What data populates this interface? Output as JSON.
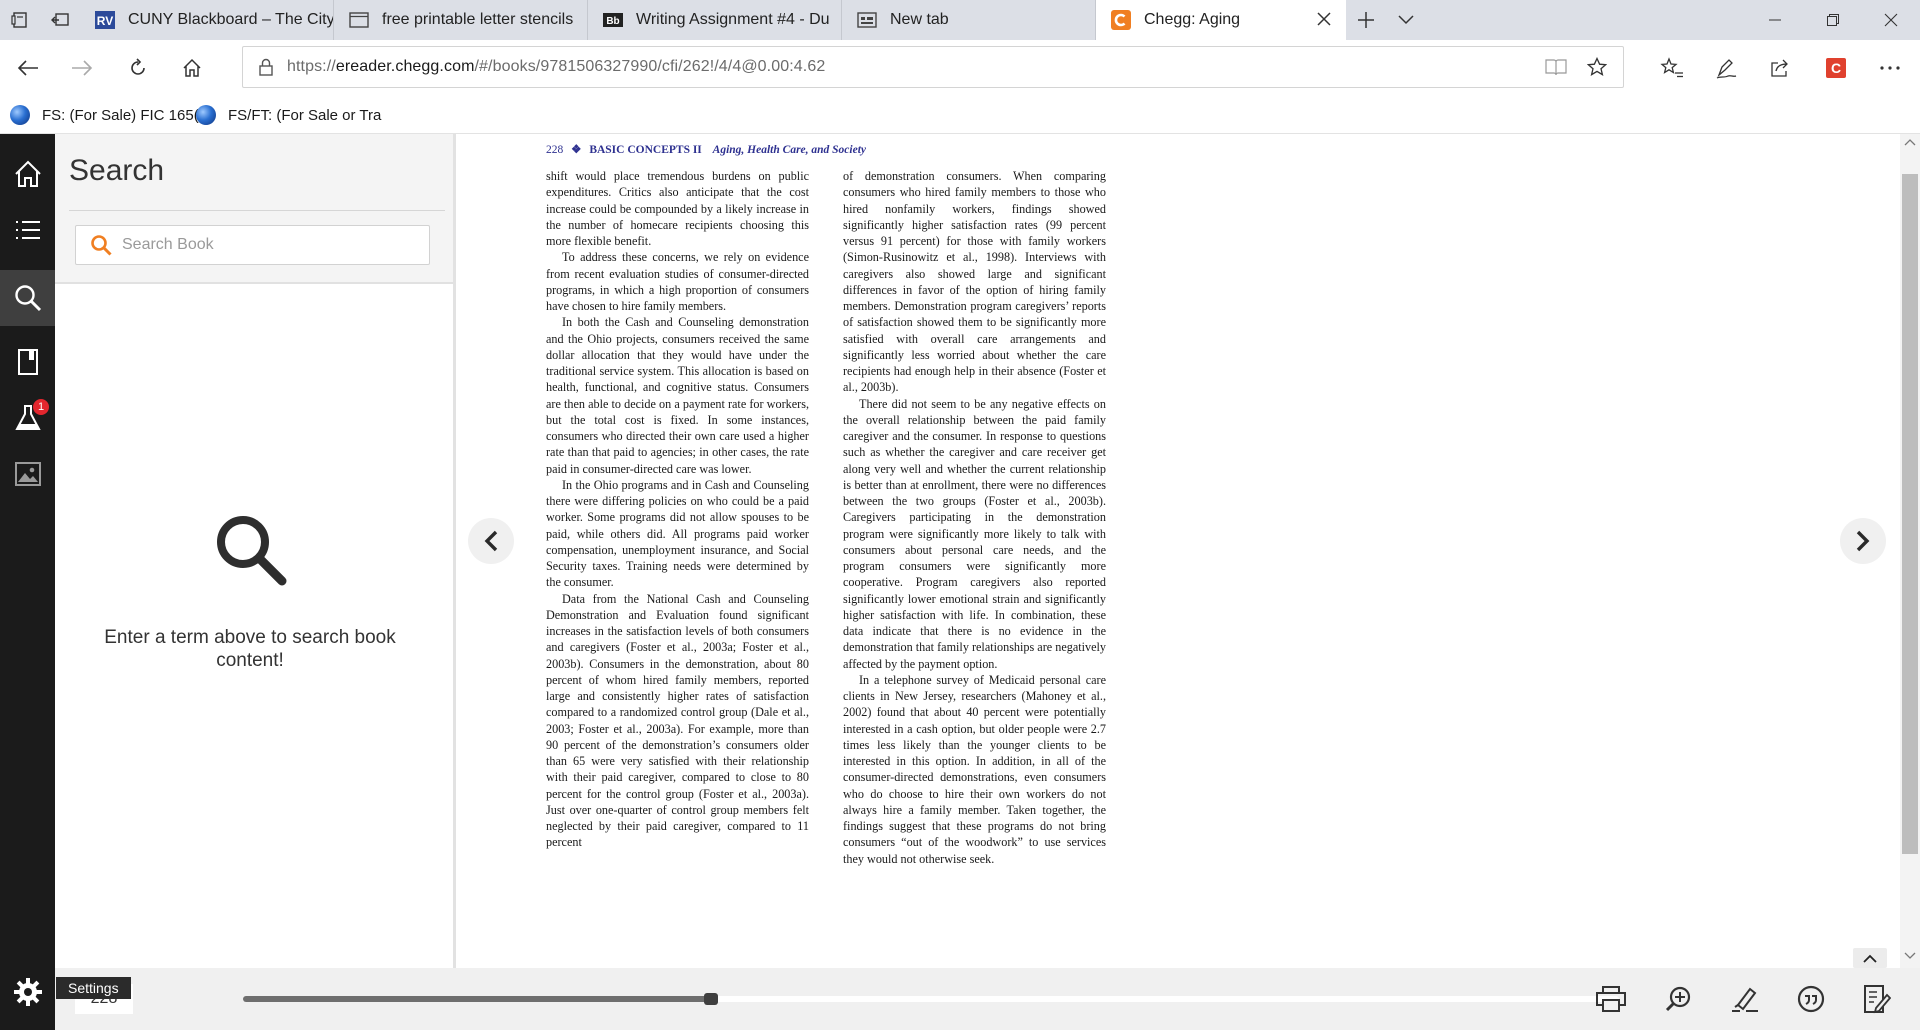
{
  "browser": {
    "tabs": [
      {
        "title": "CUNY Blackboard – The City",
        "icon": "cuny-logo-icon"
      },
      {
        "title": "free printable letter stencils",
        "icon": "page-icon"
      },
      {
        "title": "Writing Assignment #4 - Du",
        "icon": "blackboard-logo-icon"
      },
      {
        "title": "New tab",
        "icon": "new-tab-icon"
      },
      {
        "title": "Chegg: Aging",
        "icon": "chegg-logo-icon",
        "active": true
      }
    ],
    "url_prefix": "https://",
    "url_host": "ereader.chegg.com",
    "url_path": "/#/books/9781506327990/cfi/262!/4/4@0.00:4.62",
    "favorites": [
      {
        "label": "FS: (For Sale) FIC 165("
      },
      {
        "label": "FS/FT: (For Sale or Tra"
      }
    ],
    "extension_badge": "C"
  },
  "sidebar": {
    "badge_count": "1",
    "settings_tooltip": "Settings"
  },
  "search": {
    "title": "Search",
    "placeholder": "Search Book",
    "empty_message": "Enter a term above to search book content!"
  },
  "book": {
    "page_number": "228",
    "section": "BASIC CONCEPTS II",
    "book_title": "Aging, Health Care, and Society",
    "column_left": [
      "shift would place tremendous burdens on public expenditures. Critics also anticipate that the cost increase could be compounded by a likely increase in the number of homecare recipients choosing this more flexible benefit.",
      "To address these concerns, we rely on evidence from recent evaluation studies of consumer-directed programs, in which a high proportion of consumers have chosen to hire family members.",
      "In both the Cash and Counseling demonstration and the Ohio projects, consumers received the same dollar allocation that they would have under the traditional service system. This allocation is based on health, functional, and cognitive status. Consumers are then able to decide on a payment rate for workers, but the total cost is fixed. In some instances, consumers who directed their own care used a higher rate than that paid to agencies; in other cases, the rate paid in consumer-directed care was lower.",
      "In the Ohio programs and in Cash and Counseling there were differing policies on who could be a paid worker. Some programs did not allow spouses to be paid, while others did. All programs paid worker compensation, unemployment insurance, and Social Security taxes. Training needs were determined by the consumer.",
      "Data from the National Cash and Counseling Demonstration and Evaluation found significant increases in the satisfaction levels of both consumers and caregivers (Foster et al., 2003a; Foster et al., 2003b). Consumers in the demonstration, about 80 percent of whom hired family members, reported large and consistently higher rates of satisfaction compared to a randomized control group (Dale et al., 2003; Foster et al., 2003a). For example, more than 90 percent of the demonstration’s consumers older than 65 were very satisfied with their relationship with their paid caregiver, compared to close to 80 percent for the control group (Foster et al., 2003a). Just over one-quarter of control group members felt neglected by their paid caregiver, compared to 11 percent"
    ],
    "column_right": [
      "of demonstration consumers. When comparing consumers who hired family members to those who hired nonfamily workers, findings showed significantly higher satisfaction rates (99 percent versus 91 percent) for those with family workers (Simon-Rusinowitz et al., 1998). Interviews with caregivers also showed large and significant differences in favor of the option of hiring family members. Demonstration program caregivers’ reports of satisfaction showed them to be significantly more satisfied with overall care arrangements and significantly less worried about whether the care recipients had enough help in their absence (Foster et al., 2003b).",
      "There did not seem to be any negative effects on the overall relationship between the paid family caregiver and the consumer. In response to questions such as whether the caregiver and care receiver get along very well and whether the current relationship is better than at enrollment, there were no differences between the two groups (Foster et al., 2003b). Caregivers participating in the demonstration program were significantly more likely to talk with consumers about personal care needs, and the program consumers were significantly more cooperative. Program caregivers also reported significantly lower emotional strain and significantly higher satisfaction with life. In combination, these data indicate that there is no evidence in the demonstration that family relationships are negatively affected by the payment option.",
      "In a telephone survey of Medicaid personal care clients in New Jersey, researchers (Mahoney et al., 2002) found that about 40 percent were potentially interested in a cash option, but older people were 2.7 times less likely than the younger clients to be interested in this option. In addition, in all of the consumer-directed demonstrations, even consumers who do choose to hire their own workers do not always hire a family member. Taken together, the findings suggest that these programs do not bring consumers “out of the woodwork” to use services they would not otherwise seek."
    ]
  },
  "reader": {
    "current_page": "228",
    "progress_fraction": 0.34
  },
  "colors": {
    "rail_bg": "#1b1b1b",
    "accent_orange": "#f07f22",
    "running_head": "#2e3190",
    "chegg_red": "#e0412e"
  }
}
